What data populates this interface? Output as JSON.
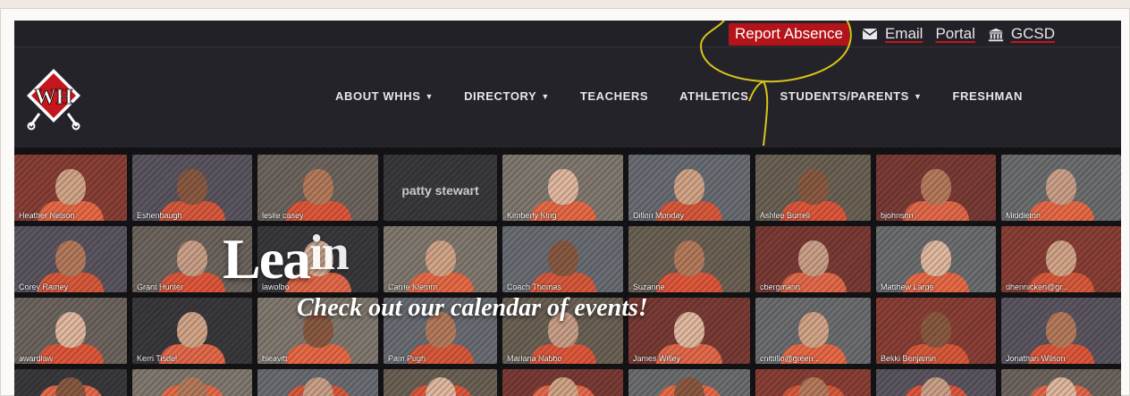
{
  "utility": {
    "report_absence": "Report Absence",
    "email": "Email",
    "portal": "Portal",
    "gcsd": "GCSD",
    "email_icon": "envelope-icon",
    "gcsd_icon": "institution-icon"
  },
  "logo": {
    "text": "WH",
    "icon": "school-logo-diamond"
  },
  "nav": {
    "items": [
      {
        "label": "ABOUT WHHS",
        "dropdown": true
      },
      {
        "label": "DIRECTORY",
        "dropdown": true
      },
      {
        "label": "TEACHERS",
        "dropdown": false
      },
      {
        "label": "ATHLETICS",
        "dropdown": false
      },
      {
        "label": "STUDENTS/PARENTS",
        "dropdown": true
      },
      {
        "label": "FRESHMAN",
        "dropdown": false
      }
    ]
  },
  "hero": {
    "headline": "Lea",
    "headline_fragment": "in",
    "subtitle": "Check out our calendar of events!",
    "tiles": [
      "Heather Nelson",
      "Eshenbaugh",
      "leslie casey",
      "patty stewart",
      "Kimberly King",
      "Dillon Monday",
      "Ashlee Burrell",
      "bjohnson",
      "Middleton",
      "Corey Ramey",
      "Grant Hunter",
      "lawolbo",
      "Carrie Klemm",
      "Coach Thomas",
      "Suzanne",
      "cbergmann",
      "Matthew Large",
      "dhennicken@gr...",
      "awardlaw",
      "Kerri Tisdel",
      "bleavitt",
      "Pam Pugh",
      "Marlana Nabbo",
      "James Willey",
      "cnittillo@green...",
      "Bekki Benjamin",
      "Jonathan Wilson"
    ]
  },
  "colors": {
    "accent_red": "#b31319",
    "nav_bg": "#25232a",
    "annotation_yellow": "#d7c51a"
  }
}
